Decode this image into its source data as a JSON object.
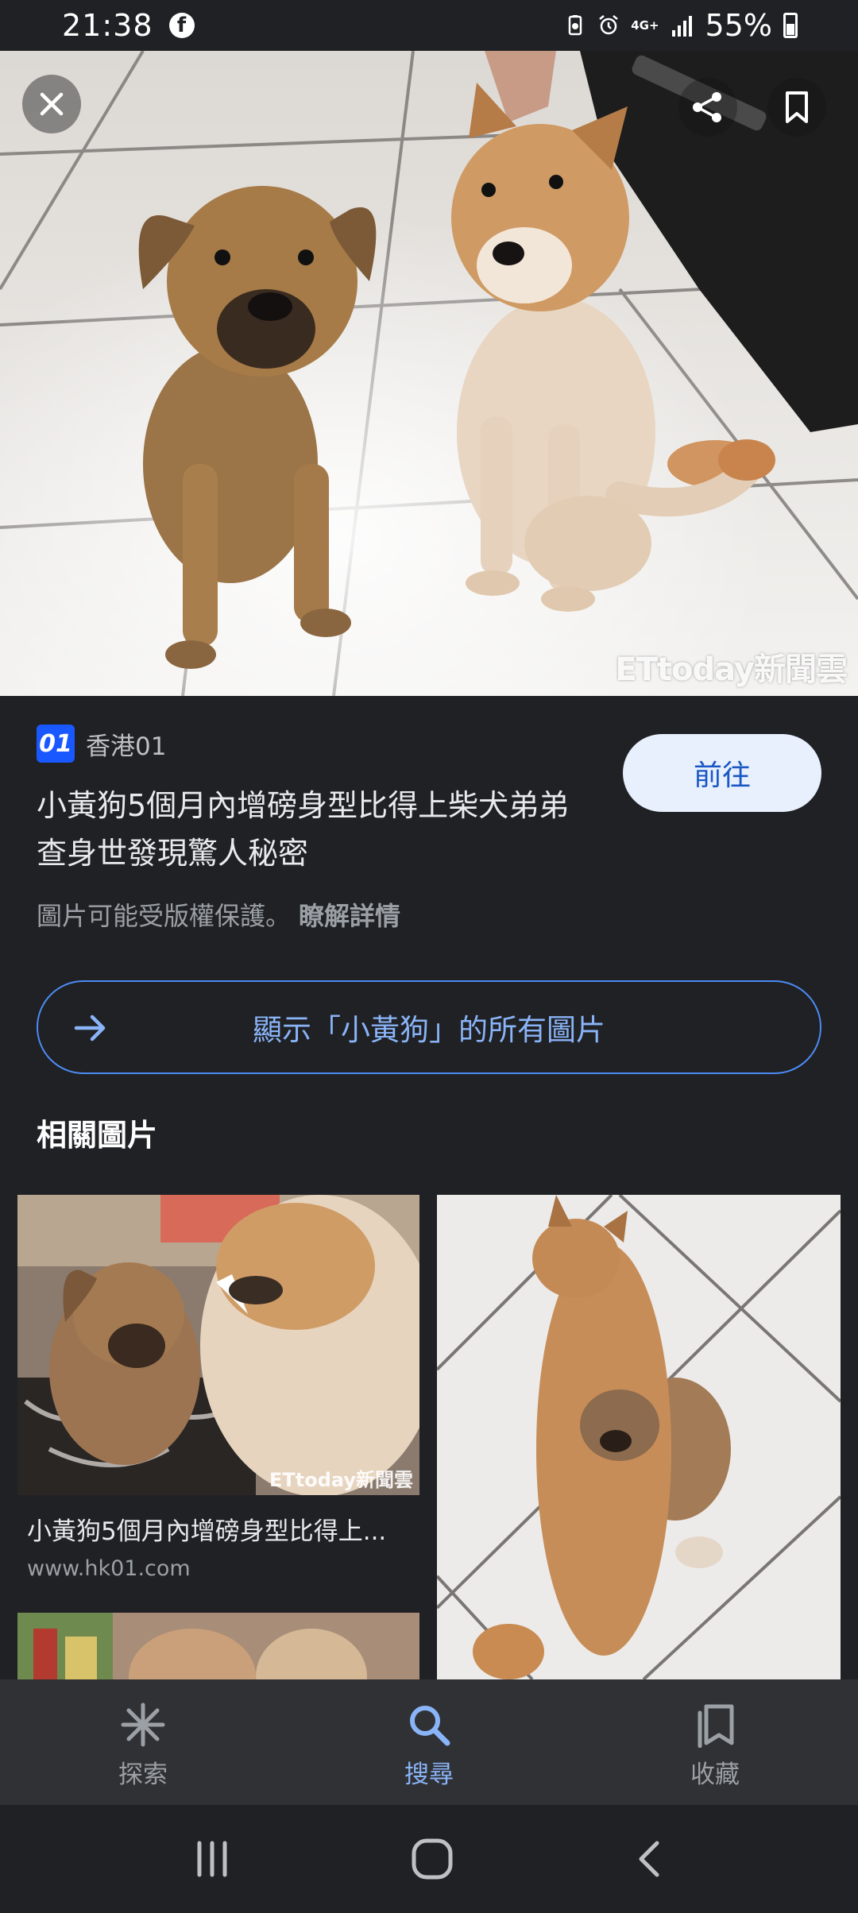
{
  "status_bar": {
    "time": "21:38",
    "network": "4G+",
    "battery": "55%"
  },
  "hero": {
    "watermark": "ETtoday新聞雲"
  },
  "result": {
    "source_name": "香港01",
    "source_logo_text": "01",
    "title": "小黃狗5個月內增磅身型比得上柴犬弟弟查身世發現驚人秘密",
    "goto_label": "前往",
    "copyright_text": "圖片可能受版權保護。",
    "learn_more_label": "瞭解詳情"
  },
  "show_all": {
    "label": "顯示「小黃狗」的所有圖片"
  },
  "related": {
    "heading": "相關圖片",
    "items": [
      {
        "title": "小黃狗5個月內增磅身型比得上...",
        "domain": "www.hk01.com",
        "watermark": "ETtoday新聞雲"
      }
    ]
  },
  "bottom_nav": {
    "items": [
      {
        "label": "探索",
        "icon": "asterisk-icon"
      },
      {
        "label": "搜尋",
        "icon": "search-icon",
        "active": true
      },
      {
        "label": "收藏",
        "icon": "collections-icon"
      }
    ]
  },
  "colors": {
    "background": "#202124",
    "accent": "#8ab4f8",
    "button_bg": "#e8f0fe",
    "nav_bg": "#303134"
  }
}
